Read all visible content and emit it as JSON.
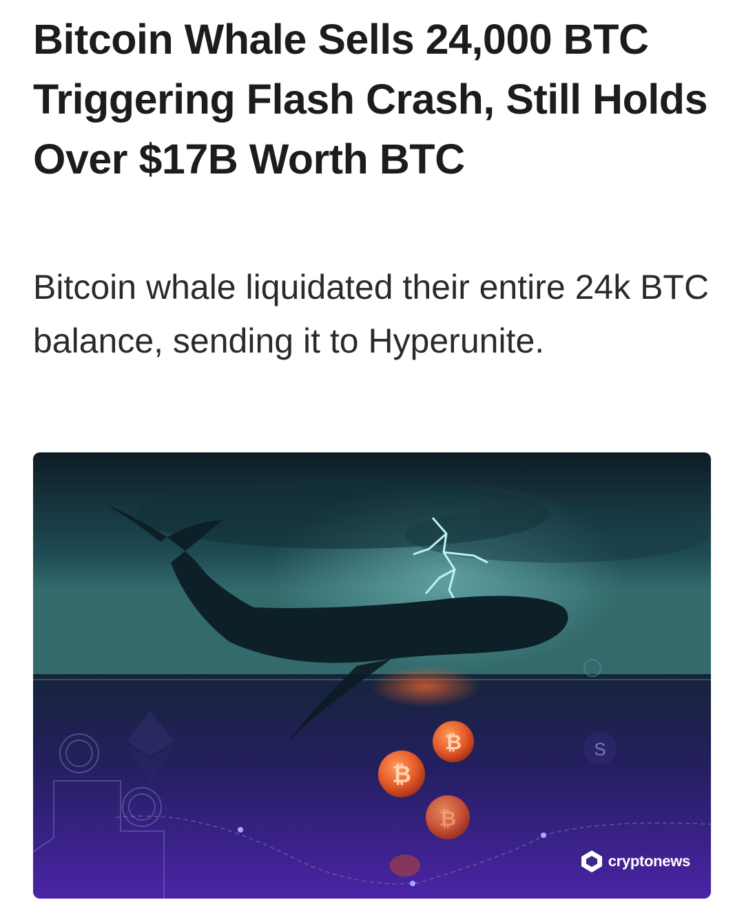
{
  "article": {
    "headline": "Bitcoin Whale Sells 24,000 BTC Triggering Flash Crash, Still Holds Over $17B Worth BTC",
    "summary": "Bitcoin whale liquidated their entire 24k BTC balance, sending it to Hyperunite."
  },
  "image": {
    "brand_name": "cryptonews",
    "icons": [
      "whale-silhouette",
      "lightning-bolt-icon",
      "bitcoin-coin-icon",
      "dollar-coin-icon",
      "ethereum-icon",
      "cryptonews-logo-icon"
    ]
  },
  "colors": {
    "headline": "#1c1c1c",
    "summary": "#2a2a2a",
    "coin_orange": "#e4592a",
    "sky_teal": "#2f6f73",
    "sea_purple": "#3a1f8c"
  }
}
